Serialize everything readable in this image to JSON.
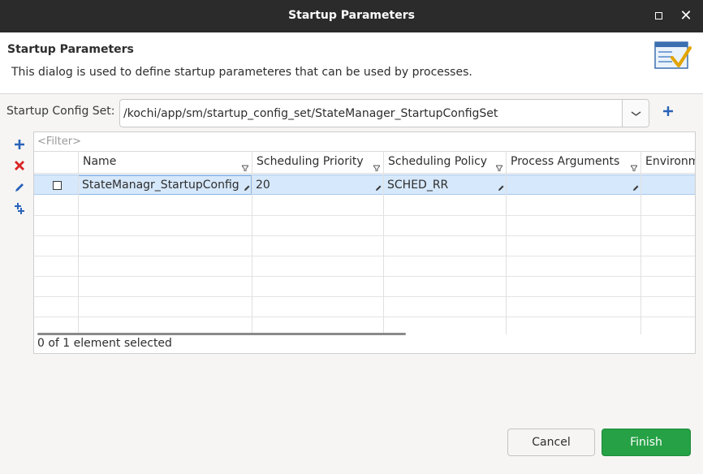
{
  "window": {
    "title": "Startup Parameters"
  },
  "header": {
    "title": "Startup Parameters",
    "description": "This dialog is used to define startup parameteres that can be used by processes.",
    "icon": "wizard-checklist-icon"
  },
  "config_set": {
    "label": "Startup Config Set:",
    "value": "/kochi/app/sm/startup_config_set/StateManager_StartupConfigSet"
  },
  "side_toolbar": {
    "icons": [
      "add-icon",
      "delete-icon",
      "edit-icon",
      "add-multiple-icon"
    ]
  },
  "table": {
    "filter_placeholder": "<Filter>",
    "columns": [
      "Name",
      "Scheduling Priority",
      "Scheduling Policy",
      "Process Arguments",
      "Environm"
    ],
    "rows": [
      {
        "checked": false,
        "name": "StateManagr_StartupConfig",
        "scheduling_priority": "20",
        "scheduling_policy": "SCHED_RR",
        "process_arguments": "",
        "environment": ""
      }
    ],
    "status": "0 of 1 element selected"
  },
  "buttons": {
    "cancel": "Cancel",
    "finish": "Finish"
  },
  "colors": {
    "finish_green": "#26a146",
    "selection": "#d6e8fb",
    "titlebar": "#2b2b2b"
  }
}
